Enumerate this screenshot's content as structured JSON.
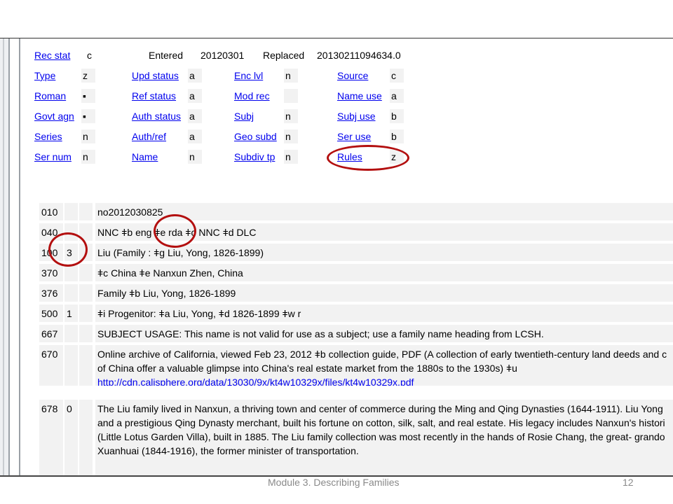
{
  "fixed": {
    "rec_stat": {
      "label": "Rec stat",
      "value": "c"
    },
    "entered": {
      "label": "Entered",
      "value": "20120301"
    },
    "replaced": {
      "label": "Replaced",
      "value": "20130211094634.0"
    },
    "col1": [
      {
        "label": "Type",
        "value": "z"
      },
      {
        "label": "Roman",
        "value": "▪"
      },
      {
        "label": "Govt agn",
        "value": "▪"
      },
      {
        "label": "Series",
        "value": "n"
      },
      {
        "label": "Ser num",
        "value": "n"
      }
    ],
    "col2": [
      {
        "label": "Upd status",
        "value": "a"
      },
      {
        "label": "Ref status",
        "value": "a"
      },
      {
        "label": "Auth status",
        "value": "a"
      },
      {
        "label": "Auth/ref",
        "value": "a"
      },
      {
        "label": "Name",
        "value": "n"
      }
    ],
    "col3": [
      {
        "label": "Enc lvl",
        "value": "n"
      },
      {
        "label": "Mod rec",
        "value": ""
      },
      {
        "label": "Subj",
        "value": "n"
      },
      {
        "label": "Geo subd",
        "value": "n"
      },
      {
        "label": "Subdiv tp",
        "value": "n"
      }
    ],
    "col4": [
      {
        "label": "Source",
        "value": "c"
      },
      {
        "label": "Name use",
        "value": "a"
      },
      {
        "label": "Subj use",
        "value": "b"
      },
      {
        "label": "Ser use",
        "value": "b"
      },
      {
        "label": "Rules",
        "value": "z"
      }
    ]
  },
  "fields": [
    {
      "tag": "010",
      "i1": "",
      "i2": "",
      "lines": [
        "no2012030825"
      ]
    },
    {
      "tag": "040",
      "i1": "",
      "i2": "",
      "lines": [
        "NNC ǂb eng ǂe rda ǂc NNC ǂd DLC"
      ]
    },
    {
      "tag": "100",
      "i1": "3",
      "i2": "",
      "lines": [
        "Liu (Family : ǂg Liu, Yong, 1826-1899)"
      ]
    },
    {
      "tag": "370",
      "i1": "",
      "i2": "",
      "lines": [
        "ǂc China ǂe Nanxun Zhen, China"
      ]
    },
    {
      "tag": "376",
      "i1": "",
      "i2": "",
      "lines": [
        "Family ǂb Liu, Yong, 1826-1899"
      ]
    },
    {
      "tag": "500",
      "i1": "1",
      "i2": "",
      "lines": [
        "ǂi Progenitor: ǂa Liu, Yong, ǂd 1826-1899 ǂw r"
      ]
    },
    {
      "tag": "667",
      "i1": "",
      "i2": "",
      "lines": [
        "SUBJECT USAGE: This name is not valid for use as a subject; use a family name heading from LCSH."
      ]
    },
    {
      "tag": "670",
      "i1": "",
      "i2": "",
      "lines": [
        "Online archive of California, viewed Feb 23, 2012 ǂb collection guide, PDF (A collection of early twentieth-century land deeds and c",
        "of China offer a valuable glimpse into China's real estate market from the 1880s to the 1930s) ǂu"
      ],
      "link": "http://cdn.calisphere.org/data/13030/9x/kt4w10329x/files/kt4w10329x.pdf"
    },
    {
      "tag": "678",
      "i1": "0",
      "i2": "",
      "lines": [
        "The Liu family lived in Nanxun, a thriving town and center of commerce during the Ming and Qing Dynasties (1644-1911). Liu Yong",
        "and a prestigious Qing Dynasty merchant, built his fortune on cotton, silk, salt, and real estate. His legacy includes Nanxun's histori",
        "(Little Lotus Garden Villa), built in 1885. The Liu family collection was most recently in the hands of Rosie Chang, the great- grando",
        "Xuanhuai (1844-1916), the former minister of transportation."
      ]
    }
  ],
  "footer": {
    "title": "Module 3. Describing Families",
    "page": "12"
  },
  "colors": {
    "link": "#0000ee",
    "annotation": "#b30f0f",
    "cell_bg": "#f2f2f2"
  }
}
